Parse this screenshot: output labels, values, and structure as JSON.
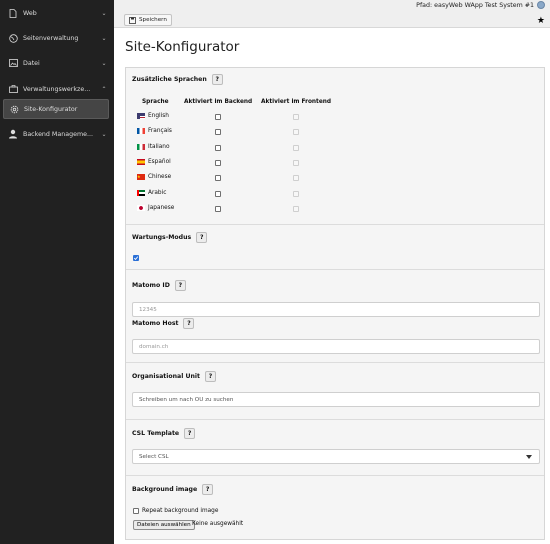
{
  "sidebar": {
    "items": [
      {
        "label": "Web",
        "icon": "page-icon"
      },
      {
        "label": "Seitenverwaltung",
        "icon": "globe-icon"
      },
      {
        "label": "Datei",
        "icon": "image-icon"
      },
      {
        "label": "Verwaltungswerkze...",
        "icon": "briefcase-icon"
      },
      {
        "label": "Site-Konfigurator",
        "icon": "gear-icon"
      },
      {
        "label": "Backend Manageme...",
        "icon": "users-icon"
      }
    ]
  },
  "topbar": {
    "path": "Pfad: easyWeb WApp Test System #1",
    "save_label": "Speichern"
  },
  "page_title": "Site-Konfigurator",
  "languages": {
    "label": "Zusätzliche Sprachen",
    "col_lang": "Sprache",
    "col_backend": "Aktiviert im Backend",
    "col_frontend": "Aktiviert im Frontend",
    "rows": [
      {
        "name": "English"
      },
      {
        "name": "Français"
      },
      {
        "name": "Italiano"
      },
      {
        "name": "Español"
      },
      {
        "name": "Chinese"
      },
      {
        "name": "Arabic"
      },
      {
        "name": "Japanese"
      }
    ]
  },
  "maintenance": {
    "label": "Wartungs-Modus"
  },
  "matomo": {
    "id_label": "Matomo ID",
    "id_placeholder": "12345",
    "host_label": "Matomo Host",
    "host_placeholder": "domain.ch"
  },
  "ou": {
    "label": "Organisational Unit",
    "placeholder": "Schreiben um nach OU zu suchen"
  },
  "csl": {
    "label": "CSL Template",
    "value": "Select CSL"
  },
  "bg": {
    "label": "Background image",
    "repeat_label": "Repeat background image",
    "file_button": "Dateien auswählen",
    "file_status": "Keine ausgewählt"
  },
  "help_mark": "?"
}
